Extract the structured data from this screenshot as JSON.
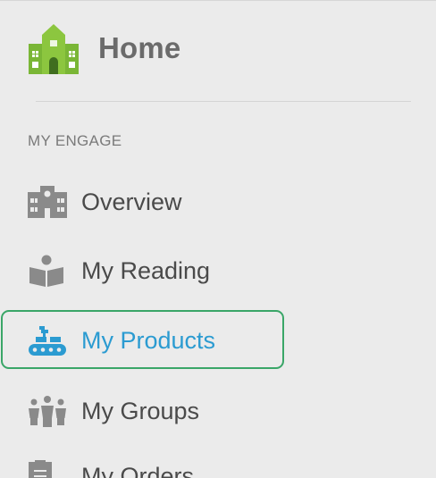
{
  "header": {
    "home_label": "Home"
  },
  "section": {
    "label": "MY ENGAGE"
  },
  "nav": {
    "items": [
      {
        "label": "Overview",
        "icon": "school-icon"
      },
      {
        "label": "My Reading",
        "icon": "reader-icon"
      },
      {
        "label": "My Products",
        "icon": "conveyor-icon",
        "active": true
      },
      {
        "label": "My Groups",
        "icon": "group-icon"
      },
      {
        "label": "My Orders",
        "icon": "clipboard-icon"
      }
    ]
  },
  "colors": {
    "background": "#ebebeb",
    "active_text": "#2b9bd1",
    "active_border": "#3aa668",
    "home_icon": "#8cc63f",
    "nav_icon": "#8a8a8a"
  }
}
